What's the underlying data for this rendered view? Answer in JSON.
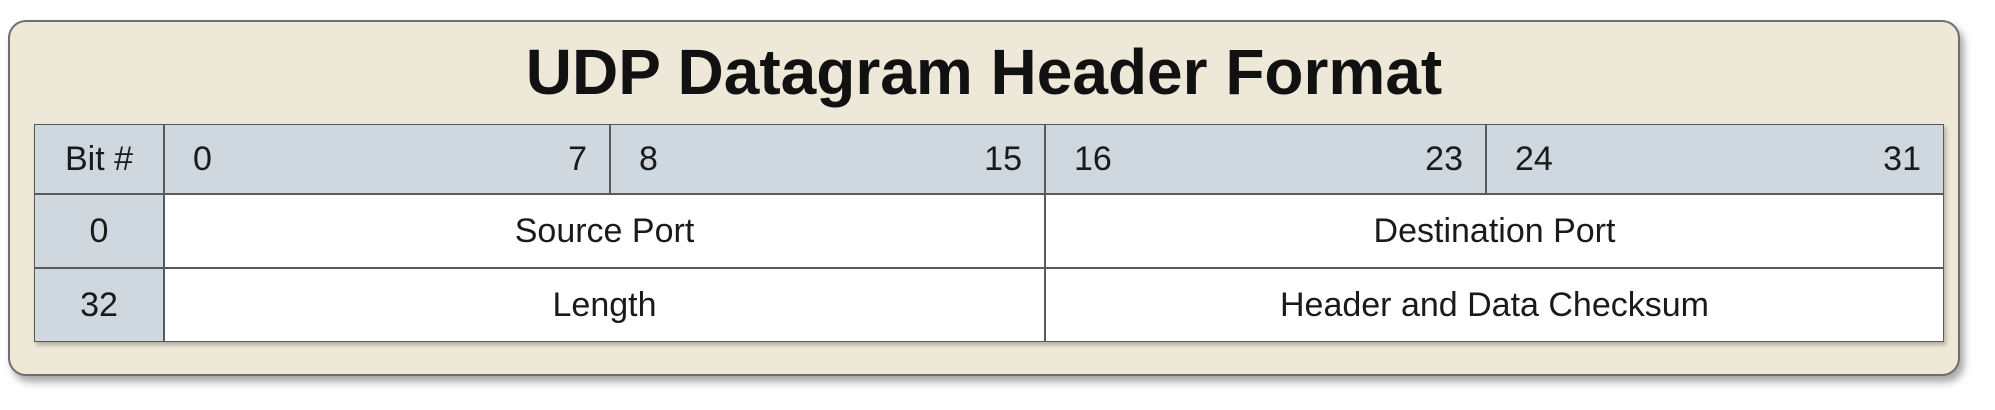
{
  "title": "UDP Datagram Header Format",
  "header": {
    "corner": "Bit #",
    "groups": [
      {
        "start": "0",
        "end": "7"
      },
      {
        "start": "8",
        "end": "15"
      },
      {
        "start": "16",
        "end": "23"
      },
      {
        "start": "24",
        "end": "31"
      }
    ]
  },
  "rows": [
    {
      "offset": "0",
      "fields": [
        "Source Port",
        "Destination Port"
      ]
    },
    {
      "offset": "32",
      "fields": [
        "Length",
        "Header and Data Checksum"
      ]
    }
  ],
  "colors": {
    "panel": "#ede8d8",
    "header_fill": "#cfd8de",
    "cell_fill": "#ffffff",
    "border": "#5a5a5a"
  }
}
